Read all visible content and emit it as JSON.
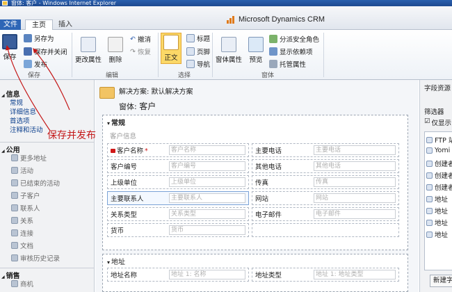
{
  "window_title": "窗体: 客户 - Windows Internet Explorer",
  "tabs": {
    "file": "文件",
    "home": "主页",
    "insert": "插入"
  },
  "brand": "Microsoft Dynamics CRM",
  "ribbon": {
    "save": "保存",
    "save_as": "另存为",
    "save_close": "保存并关闭",
    "publish": "发布",
    "group_save": "保存",
    "change_props": "更改属性",
    "delete": "删除",
    "undo": "撤消",
    "redo": "恢复",
    "group_edit": "编辑",
    "body": "正文",
    "header": "标题",
    "footer": "页脚",
    "nav": "导航",
    "group_select": "选择",
    "form_props": "窗体属性",
    "preview": "预览",
    "manage_roles": "分派安全角色",
    "show_deps": "显示依赖项",
    "managed_props": "托管属性",
    "group_form": "窗体"
  },
  "nav": {
    "info_header": "信息",
    "info_links": [
      "常规",
      "详细信息",
      "首选项",
      "注释和活动"
    ],
    "common_header": "公用",
    "common_items": [
      "更多地址",
      "活动",
      "已结束的活动",
      "子客户",
      "联系人",
      "关系",
      "连接",
      "文档",
      "审核历史记录"
    ],
    "sales_header": "销售",
    "sales_items": [
      "商机"
    ]
  },
  "form": {
    "solution": "解决方案: 默认解决方案",
    "title_prefix": "窗体:",
    "title_name": "客户",
    "section_general": "常规",
    "section_sub": "客户信息",
    "fields_left": [
      {
        "label": "客户名称",
        "placeholder": "客户名称"
      },
      {
        "label": "客户编号",
        "placeholder": "客户编号"
      },
      {
        "label": "上级单位",
        "placeholder": "上级单位"
      },
      {
        "label": "主要联系人",
        "placeholder": "主要联系人"
      },
      {
        "label": "关系类型",
        "placeholder": "关系类型"
      },
      {
        "label": "货币",
        "placeholder": "货币"
      }
    ],
    "fields_right": [
      {
        "label": "主要电话",
        "placeholder": "主要电话"
      },
      {
        "label": "其他电话",
        "placeholder": "其他电话"
      },
      {
        "label": "传真",
        "placeholder": "传真"
      },
      {
        "label": "网站",
        "placeholder": "网站"
      },
      {
        "label": "电子邮件",
        "placeholder": "电子邮件"
      }
    ],
    "required_mark": "*",
    "section_address": "地址",
    "address_left": {
      "label": "地址名称",
      "placeholder": "地址 1: 名称"
    },
    "address_right": {
      "label": "地址类型",
      "placeholder": "地址 1: 地址类型"
    }
  },
  "field_panel": {
    "title": "字段资源",
    "filter": "筛选器",
    "only_show": "仅显示",
    "items": [
      "FTP 站点",
      "Yomi",
      "创建者",
      "创建者",
      "创建者",
      "地址",
      "地址",
      "地址",
      "地址"
    ],
    "new_button": "新建字段"
  },
  "annotation": "保存并发布",
  "colors": {
    "red": "#c41818",
    "ribbon_active": "#fbd867",
    "file_tab": "#2e66b6"
  }
}
